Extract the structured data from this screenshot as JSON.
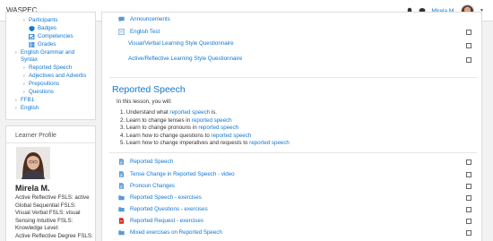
{
  "navbar": {
    "brand": "WASPEC",
    "user_name": "Mirela M."
  },
  "course_nav": {
    "items": [
      {
        "label": "Participants",
        "chevron": true
      },
      {
        "label": "Badges",
        "icon": "shield-icon"
      },
      {
        "label": "Competencies",
        "icon": "checkbox-icon"
      },
      {
        "label": "Grades",
        "icon": "table-icon"
      },
      {
        "label": "English Grammar and Syntax",
        "chevron": true
      },
      {
        "label": "Reported Speech",
        "chevron": true
      },
      {
        "label": "Adjectives and Adverbs",
        "chevron": true
      },
      {
        "label": "Prepositions",
        "chevron": true
      },
      {
        "label": "Questions",
        "chevron": true
      },
      {
        "label": "FFB1",
        "chevron": true
      },
      {
        "label": "English",
        "chevron": true
      }
    ]
  },
  "learner_profile": {
    "title": "Learner Profile",
    "name": "Mirela M.",
    "lines": [
      "Active Reflective FSLS: active",
      "Global Sequential FSLS:",
      "Visual Verbal FSLS: visual",
      "Sensing Intuitive FSLS:",
      "Knowledge Level:",
      "Active Reflective Degree FSLS:"
    ]
  },
  "top_section": {
    "announcements": "Announcements",
    "english_test": "English Test",
    "q1": "Visual/Verbal Learning Style Questionnaire",
    "q2": "Active/Reflective Learning Style Questionnaire"
  },
  "reported_speech": {
    "title": "Reported Speech",
    "intro": "In this lesson, you will:",
    "objectives": [
      {
        "n": "1.",
        "pre": "Understand what ",
        "link": "reported speech",
        "post": " is."
      },
      {
        "n": "2.",
        "pre": "Learn to change tenses in ",
        "link": "reported speech",
        "post": ""
      },
      {
        "n": "3.",
        "pre": "Learn to change pronouns in ",
        "link": "reported speech",
        "post": ""
      },
      {
        "n": "4.",
        "pre": "Learn how to change questions to ",
        "link": "reported speech",
        "post": ""
      },
      {
        "n": "5.",
        "pre": "Learn how to change imperatives and requests to ",
        "link": "reported speech",
        "post": ""
      }
    ],
    "activities": [
      {
        "label": "Reported Speech",
        "icon": "page-icon"
      },
      {
        "label": "Tense Change in Reported Speech - video",
        "icon": "page-icon"
      },
      {
        "label": "Pronoun Changes",
        "icon": "page-icon"
      },
      {
        "label": "Reported Speech - exercises",
        "icon": "folder-icon"
      },
      {
        "label": "Reported Questions - exercises",
        "icon": "folder-icon"
      },
      {
        "label": "Reported Request - exercises",
        "icon": "pdf-icon"
      },
      {
        "label": "Mixed exercises on Reported Speech",
        "icon": "folder-icon"
      }
    ]
  },
  "colors": {
    "link": "#1177d1",
    "pdf_red": "#d9261c",
    "folder_blue": "#5b9bd5"
  }
}
